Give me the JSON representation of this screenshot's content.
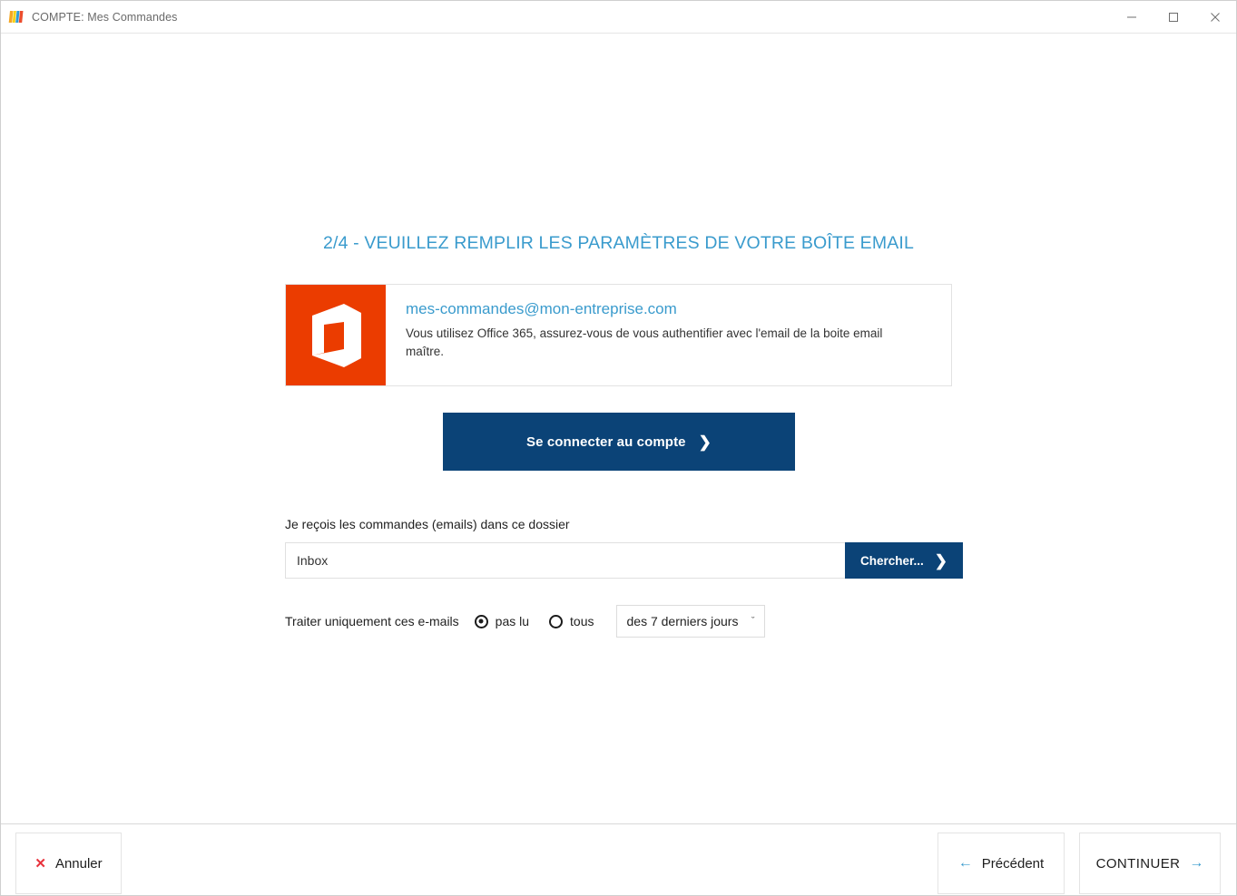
{
  "titlebar": {
    "title": "COMPTE: Mes Commandes",
    "logo_icon": "app-bars-logo-icon",
    "minimize_icon": "minimize-icon",
    "maximize_icon": "maximize-icon",
    "close_icon": "close-icon"
  },
  "main": {
    "page_title": "2/4 - VEUILLEZ REMPLIR LES PARAMÈTRES DE VOTRE BOÎTE EMAIL",
    "info_box": {
      "provider_icon": "office-365-logo-icon",
      "email": "mes-commandes@mon-entreprise.com",
      "description": "Vous utilisez Office 365, assurez-vous de vous authentifier avec l'email de la boite email maître."
    },
    "connect_button": {
      "label": "Se connecter au compte",
      "chevron": "❯"
    },
    "folder_field": {
      "label": "Je reçois les commandes (emails) dans ce dossier",
      "value": "Inbox",
      "placeholder": "Inbox",
      "search_button_label": "Chercher...",
      "search_button_chevron": "❯"
    },
    "filter_row": {
      "label": "Traiter uniquement ces e-mails",
      "options": [
        {
          "label": "pas lu",
          "selected": true
        },
        {
          "label": "tous",
          "selected": false
        }
      ],
      "period_select": {
        "value": "des 7 derniers jours",
        "caret": "ˇ"
      }
    }
  },
  "footer": {
    "cancel": {
      "label": "Annuler",
      "icon": "✕"
    },
    "previous": {
      "label": "Précédent",
      "icon": "←"
    },
    "continue": {
      "label": "CONTINUER",
      "icon": "→"
    }
  },
  "colors": {
    "accent_blue": "#3a9bcd",
    "primary_dark_blue": "#0b4377",
    "office_orange": "#eb3c00",
    "cancel_red": "#e8323c"
  }
}
